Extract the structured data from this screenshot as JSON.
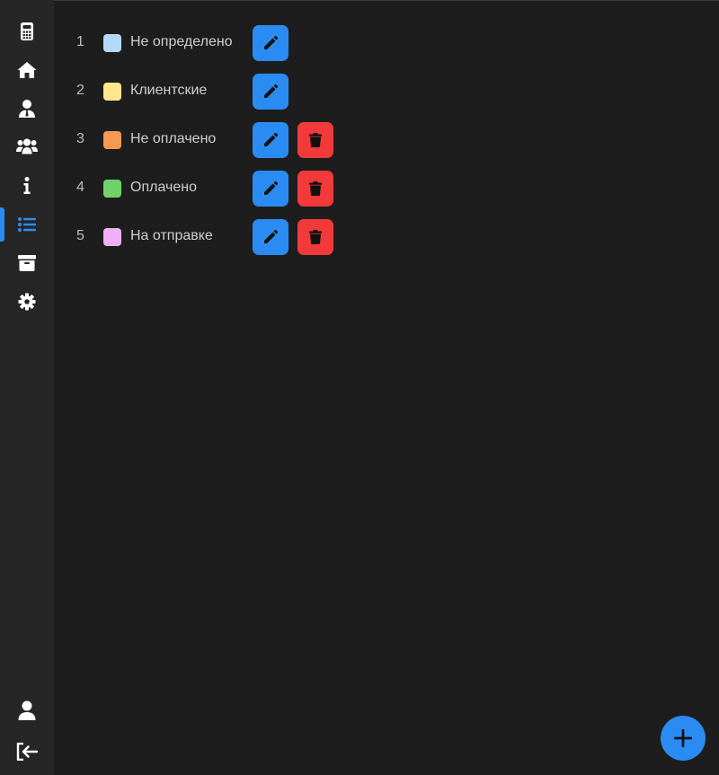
{
  "sidebar": {
    "items": [
      {
        "icon": "calculator-icon",
        "name": "sidebar-item-calculator",
        "active": false
      },
      {
        "icon": "home-icon",
        "name": "sidebar-item-home",
        "active": false
      },
      {
        "icon": "user-tie-icon",
        "name": "sidebar-item-employee",
        "active": false
      },
      {
        "icon": "users-icon",
        "name": "sidebar-item-clients",
        "active": false
      },
      {
        "icon": "info-icon",
        "name": "sidebar-item-info",
        "active": false
      },
      {
        "icon": "list-icon",
        "name": "sidebar-item-statuses",
        "active": true
      },
      {
        "icon": "archive-icon",
        "name": "sidebar-item-archive",
        "active": false
      },
      {
        "icon": "gear-icon",
        "name": "sidebar-item-settings",
        "active": false
      }
    ],
    "bottom_items": [
      {
        "icon": "user-icon",
        "name": "sidebar-item-profile"
      },
      {
        "icon": "logout-icon",
        "name": "sidebar-item-logout"
      }
    ]
  },
  "statuses": [
    {
      "num": "1",
      "label": "Не определено",
      "color": "#b3d9fb",
      "deletable": false
    },
    {
      "num": "2",
      "label": "Клиентские",
      "color": "#fde68c",
      "deletable": false
    },
    {
      "num": "3",
      "label": "Не оплачено",
      "color": "#f59a55",
      "deletable": true
    },
    {
      "num": "4",
      "label": "Оплачено",
      "color": "#6fd36a",
      "deletable": true
    },
    {
      "num": "5",
      "label": "На отправке",
      "color": "#efb0f7",
      "deletable": true
    }
  ],
  "colors": {
    "accent": "#2a8cf2",
    "danger": "#f23a3a",
    "sidebar_bg": "#262626",
    "main_bg": "#1d1d1d"
  },
  "fab": {
    "icon": "plus-icon"
  }
}
